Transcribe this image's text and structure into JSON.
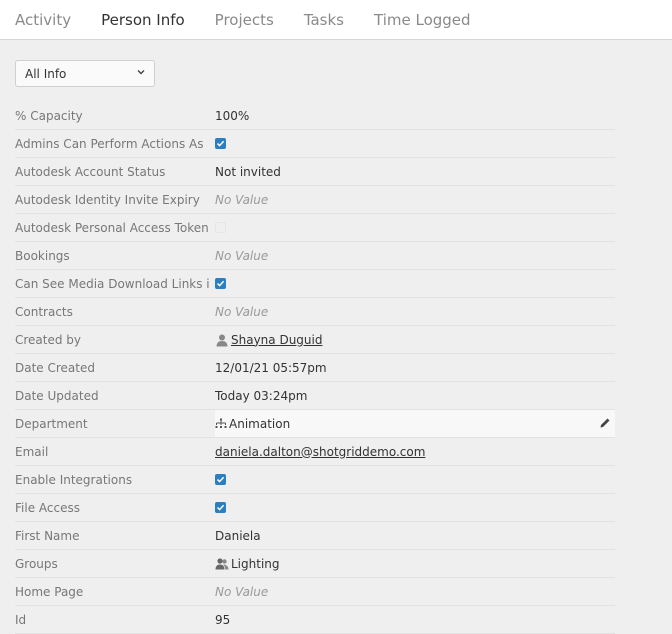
{
  "tabs": [
    {
      "label": "Activity",
      "active": false
    },
    {
      "label": "Person Info",
      "active": true
    },
    {
      "label": "Projects",
      "active": false
    },
    {
      "label": "Tasks",
      "active": false
    },
    {
      "label": "Time Logged",
      "active": false
    }
  ],
  "filter": {
    "selected": "All Info"
  },
  "fields": [
    {
      "label": "% Capacity",
      "value": "100%"
    },
    {
      "label": "Admins Can Perform Actions As",
      "checked": true
    },
    {
      "label": "Autodesk Account Status",
      "value": "Not invited"
    },
    {
      "label": "Autodesk Identity Invite Expiry",
      "value": "No Value"
    },
    {
      "label": "Autodesk Personal Access Token",
      "checked": false
    },
    {
      "label": "Bookings",
      "value": "No Value"
    },
    {
      "label": "Can See Media Download Links i",
      "checked": true
    },
    {
      "label": "Contracts",
      "value": "No Value"
    },
    {
      "label": "Created by",
      "value": "Shayna Duguid",
      "icon": "person-icon"
    },
    {
      "label": "Date Created",
      "value": "12/01/21 05:57pm"
    },
    {
      "label": "Date Updated",
      "value": "Today 03:24pm"
    },
    {
      "label": "Department",
      "value": "Animation",
      "icon": "org-chart-icon"
    },
    {
      "label": "Email",
      "value": "daniela.dalton@shotgriddemo.com"
    },
    {
      "label": "Enable Integrations",
      "checked": true
    },
    {
      "label": "File Access",
      "checked": true
    },
    {
      "label": "First Name",
      "value": "Daniela"
    },
    {
      "label": "Groups",
      "value": "Lighting",
      "icon": "group-icon"
    },
    {
      "label": "Home Page",
      "value": "No Value"
    },
    {
      "label": "Id",
      "value": "95"
    }
  ],
  "colors": {
    "accent": "#2b7fc0"
  }
}
